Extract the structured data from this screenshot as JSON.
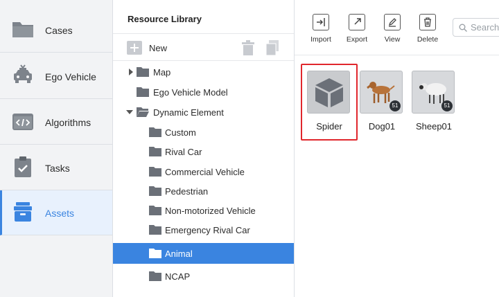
{
  "nav": {
    "items": [
      {
        "label": "Cases",
        "icon": "folder-icon"
      },
      {
        "label": "Ego Vehicle",
        "icon": "car-icon"
      },
      {
        "label": "Algorithms",
        "icon": "code-icon"
      },
      {
        "label": "Tasks",
        "icon": "clipboard-check-icon"
      },
      {
        "label": "Assets",
        "icon": "archive-box-icon",
        "active": true
      }
    ]
  },
  "tree": {
    "title": "Resource Library",
    "new_label": "New",
    "rows": [
      {
        "label": "Map",
        "level": 0,
        "caret": "right"
      },
      {
        "label": "Ego Vehicle Model",
        "level": 0,
        "caret": "none"
      },
      {
        "label": "Dynamic Element",
        "level": 0,
        "caret": "down"
      },
      {
        "label": "Custom",
        "level": 1
      },
      {
        "label": "Rival Car",
        "level": 1
      },
      {
        "label": "Commercial Vehicle",
        "level": 1
      },
      {
        "label": "Pedestrian",
        "level": 1
      },
      {
        "label": "Non-motorized Vehicle",
        "level": 1
      },
      {
        "label": "Emergency Rival Car",
        "level": 1
      },
      {
        "label": "Animal",
        "level": 1,
        "selected": true
      },
      {
        "label": "NCAP",
        "level": 1
      }
    ]
  },
  "toolbar": {
    "import_label": "Import",
    "export_label": "Export",
    "view_label": "View",
    "delete_label": "Delete",
    "search_placeholder": "Search"
  },
  "assets": [
    {
      "name": "Spider",
      "badge": "",
      "highlighted": true
    },
    {
      "name": "Dog01",
      "badge": "51"
    },
    {
      "name": "Sheep01",
      "badge": "51"
    }
  ],
  "colors": {
    "accent": "#3a84e0",
    "highlight": "#e0262c"
  }
}
